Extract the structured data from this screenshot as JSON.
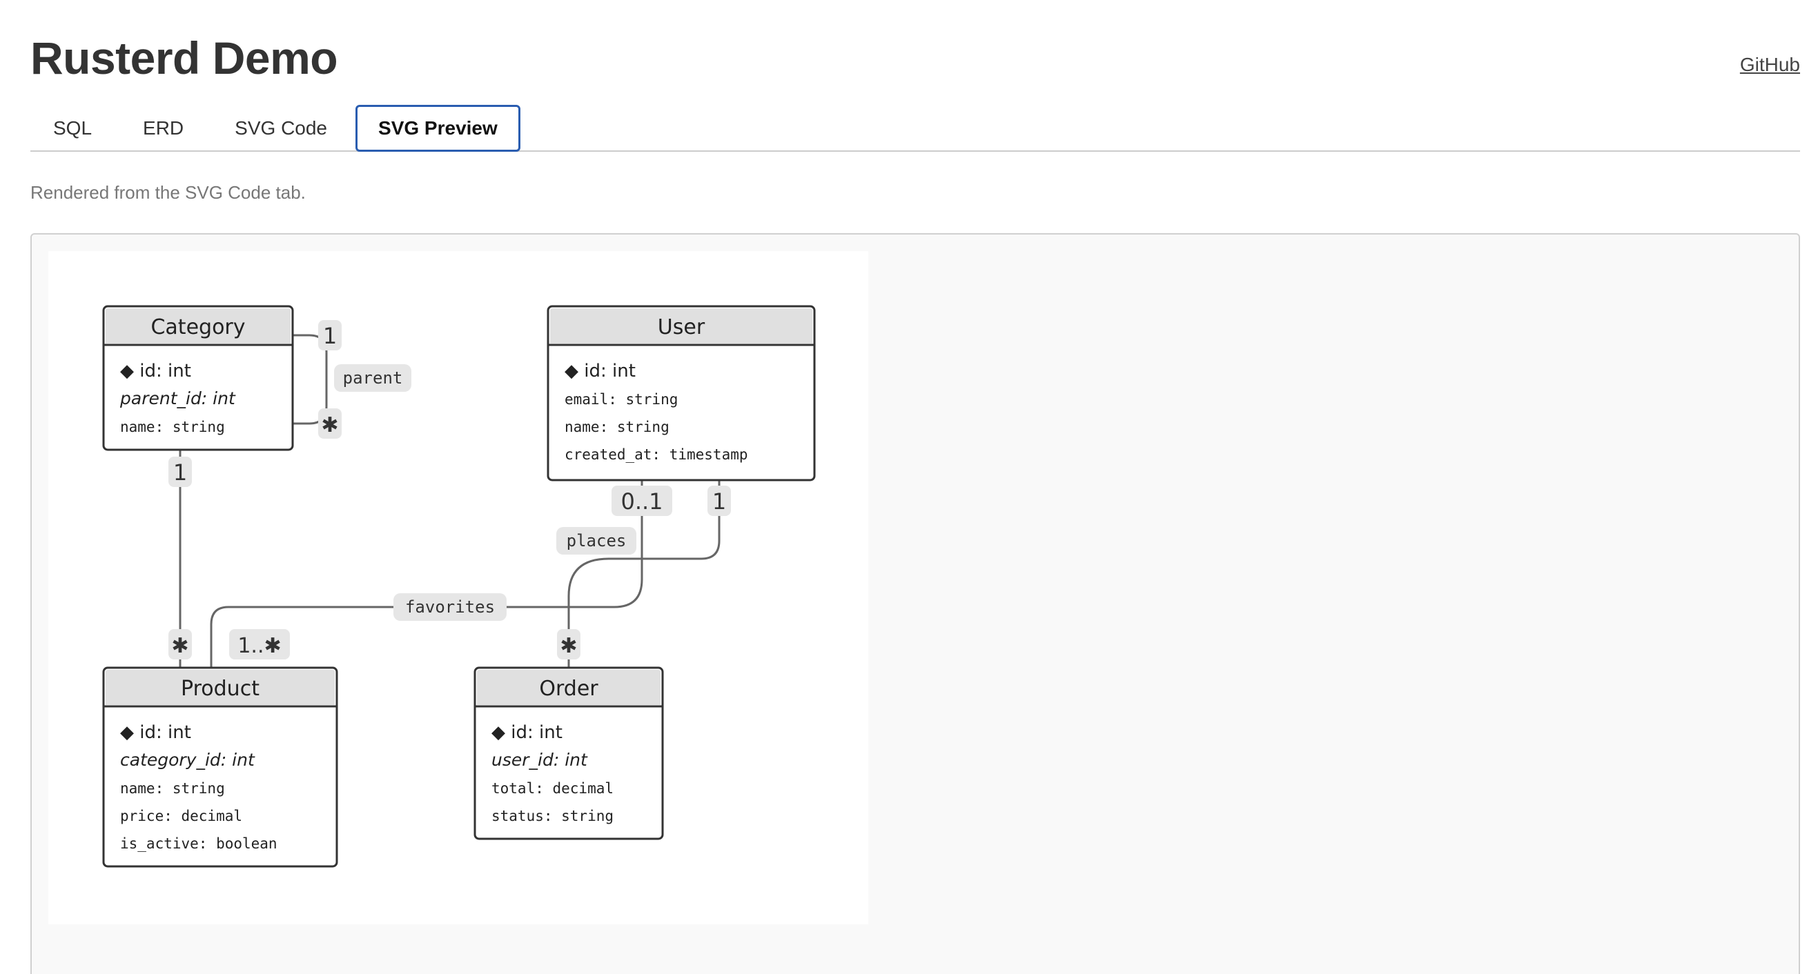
{
  "header": {
    "title": "Rusterd Demo",
    "github_link": "GitHub"
  },
  "tabs": [
    {
      "label": "SQL",
      "active": false
    },
    {
      "label": "ERD",
      "active": false
    },
    {
      "label": "SVG Code",
      "active": false
    },
    {
      "label": "SVG Preview",
      "active": true
    }
  ],
  "preview": {
    "hint": "Rendered from the SVG Code tab."
  },
  "diagram": {
    "entities": {
      "category": {
        "name": "Category",
        "fields": [
          "◆ id: int",
          "parent_id: int",
          "name: string"
        ]
      },
      "user": {
        "name": "User",
        "fields": [
          "◆ id: int",
          "email: string",
          "name: string",
          "created_at: timestamp"
        ]
      },
      "product": {
        "name": "Product",
        "fields": [
          "◆ id: int",
          "category_id: int",
          "name: string",
          "price: decimal",
          "is_active: boolean"
        ]
      },
      "order": {
        "name": "Order",
        "fields": [
          "◆ id: int",
          "user_id: int",
          "total: decimal",
          "status: string"
        ]
      }
    },
    "relations": {
      "parent": {
        "label": "parent",
        "from_card": "1",
        "to_card": "✱"
      },
      "category_product": {
        "from_card": "1",
        "to_card": "✱"
      },
      "favorites": {
        "label": "favorites",
        "from_card": "0..1",
        "to_card": "1..✱"
      },
      "places": {
        "label": "places",
        "from_card": "1",
        "to_card": "✱"
      }
    }
  },
  "colors": {
    "accent": "#2a5db0",
    "entity_header": "#e0e0e0",
    "edge": "#666666",
    "badge": "#e6e6e6"
  }
}
